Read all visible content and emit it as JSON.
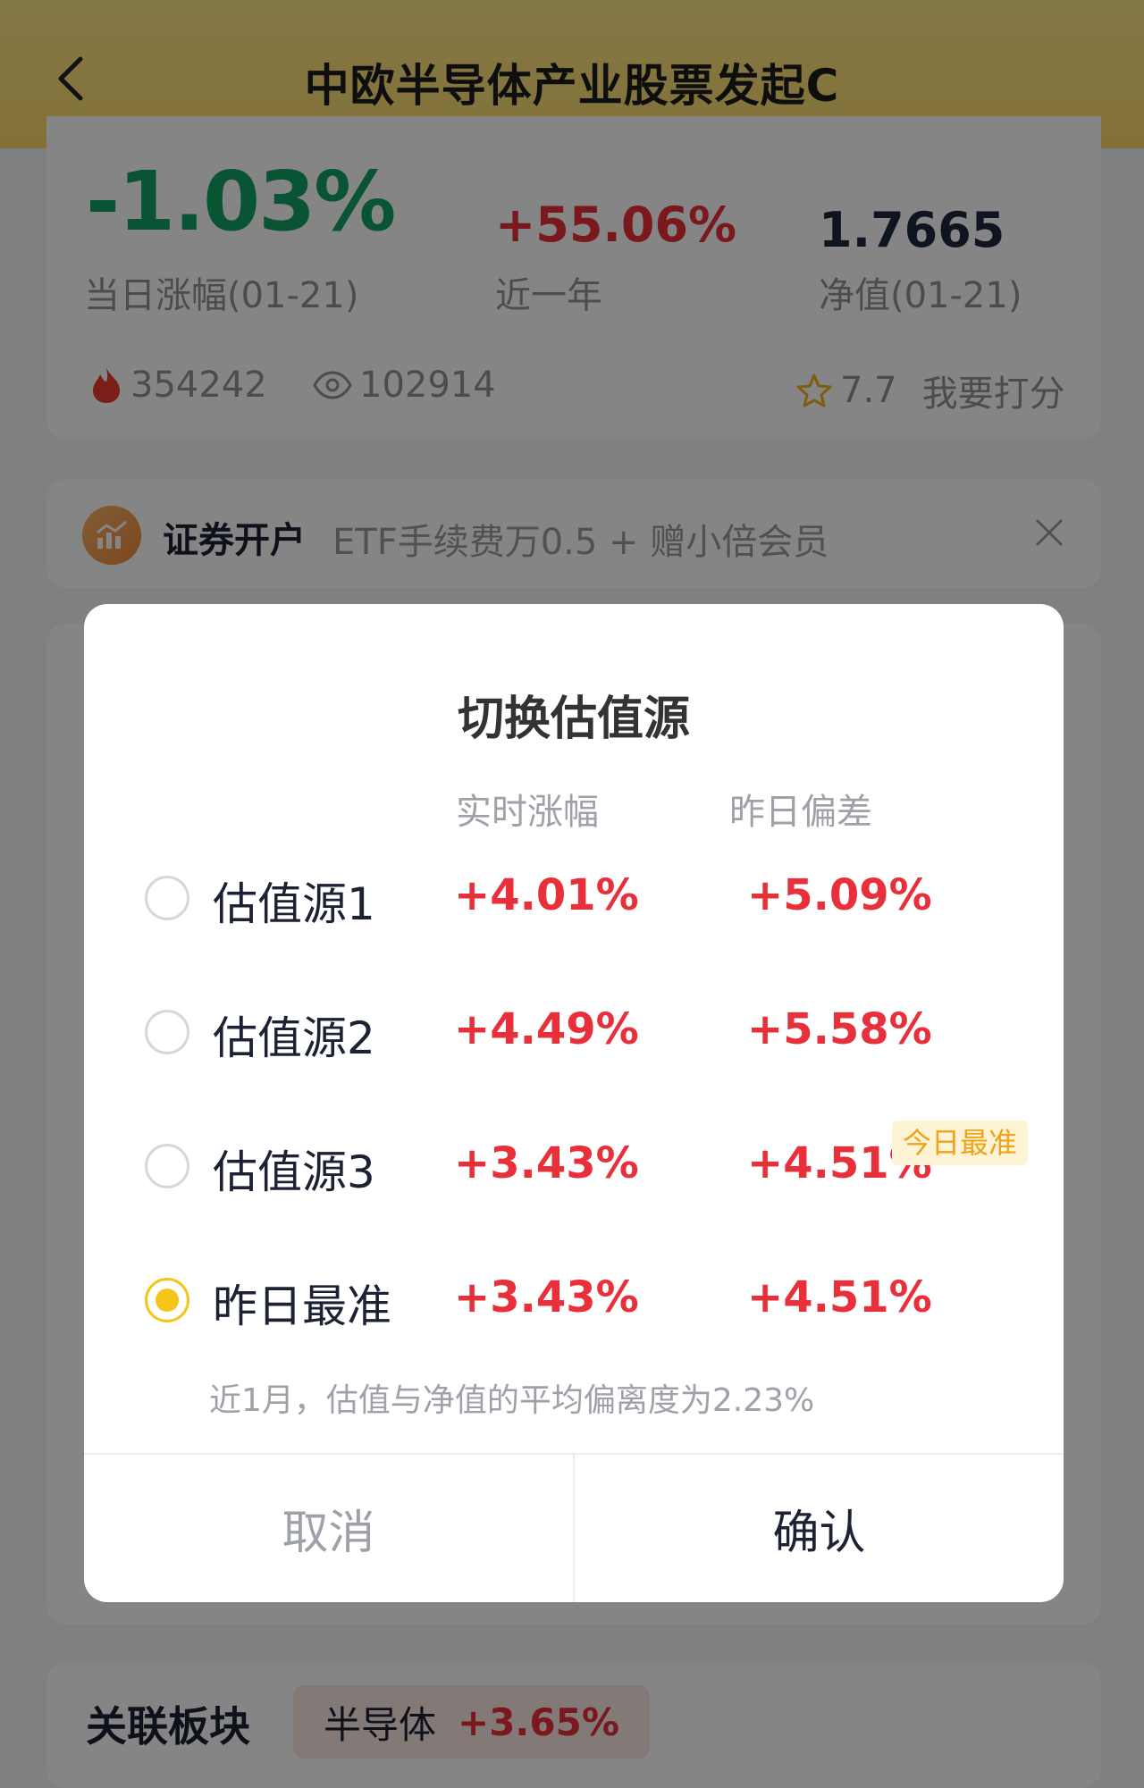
{
  "header": {
    "title": "中欧半导体产业股票发起C"
  },
  "stats": {
    "day_change": "-1.03%",
    "day_change_label": "当日涨幅(01-21)",
    "year_change": "+55.06%",
    "year_change_label": "近一年",
    "nav": "1.7665",
    "nav_label": "净值(01-21)",
    "hot_count": "354242",
    "view_count": "102914",
    "score": "7.7",
    "rate_label": "我要打分"
  },
  "promo": {
    "title": "证券开户",
    "text": "ETF手续费万0.5 + 赠小倍会员"
  },
  "sector": {
    "title": "关联板块",
    "name": "半导体",
    "value": "+3.65%"
  },
  "dialog": {
    "title": "切换估值源",
    "col_realtime": "实时涨幅",
    "col_deviation": "昨日偏差",
    "options": [
      {
        "name": "估值源1",
        "realtime": "+4.01%",
        "deviation": "+5.09%"
      },
      {
        "name": "估值源2",
        "realtime": "+4.49%",
        "deviation": "+5.58%"
      },
      {
        "name": "估值源3",
        "realtime": "+3.43%",
        "deviation": "+4.51%",
        "badge": "今日最准"
      },
      {
        "name": "昨日最准",
        "realtime": "+3.43%",
        "deviation": "+4.51%"
      }
    ],
    "selected_index": 3,
    "note": "近1月，估值与净值的平均偏离度为2.23%",
    "cancel_label": "取消",
    "confirm_label": "确认"
  },
  "colors": {
    "header_bg": "#fcd96a",
    "down_green": "#11a265",
    "up_red": "#e8303b",
    "radio_selected": "#f5c518",
    "badge_text": "#efa21a"
  }
}
